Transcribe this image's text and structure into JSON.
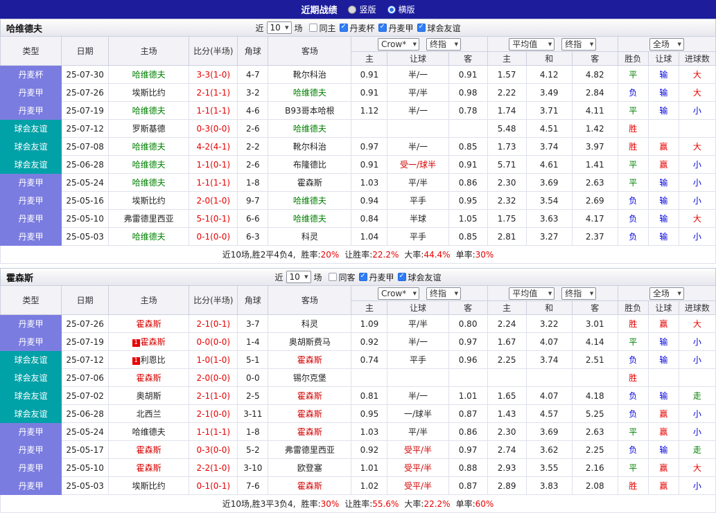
{
  "title_bar": {
    "title": "近期战绩",
    "view_options": [
      {
        "label": "竖版",
        "selected": false
      },
      {
        "label": "横版",
        "selected": true
      }
    ]
  },
  "table_columns": [
    "类型",
    "日期",
    "主场",
    "比分(半场)",
    "角球",
    "客场",
    "主",
    "让球",
    "客",
    "主",
    "和",
    "客",
    "胜负",
    "让球",
    "进球数"
  ],
  "colors": {
    "league_type": "#7b7ce0",
    "friendly_type": "#00a1a7",
    "win": "#e60000",
    "draw": "#008000",
    "loss": "#0000dc",
    "title_bar_bg": "#1d1d9c"
  },
  "sections": [
    {
      "team": "哈维德夫",
      "filters": {
        "near_label": "近",
        "match_count": "10",
        "unit_label": "场",
        "options": [
          {
            "label": "同主",
            "checked": false
          },
          {
            "label": "丹麦杯",
            "checked": true
          },
          {
            "label": "丹麦甲",
            "checked": true
          },
          {
            "label": "球会友谊",
            "checked": true
          }
        ]
      },
      "selectors": {
        "bookmaker": "Crow*",
        "odds_stage": "终指",
        "average": "平均值",
        "average_stage": "终指",
        "scope": "全场"
      },
      "rows": [
        {
          "type": "丹麦杯",
          "date": "25-07-30",
          "home": "哈维德夫",
          "home_hl": "green",
          "score": "3-3(1-0)",
          "corner": "4-7",
          "away": "靴尔科治",
          "odds": [
            "0.91",
            "半/一",
            "0.91"
          ],
          "avg": [
            "1.57",
            "4.12",
            "4.82"
          ],
          "result": "平",
          "hcp": "输",
          "goal": "大"
        },
        {
          "type": "丹麦甲",
          "date": "25-07-26",
          "home": "埃斯比约",
          "score": "2-1(1-1)",
          "corner": "3-2",
          "away": "哈维德夫",
          "away_hl": "green",
          "odds": [
            "0.91",
            "平/半",
            "0.98"
          ],
          "avg": [
            "2.22",
            "3.49",
            "2.84"
          ],
          "result": "负",
          "hcp": "输",
          "goal": "大"
        },
        {
          "type": "丹麦甲",
          "date": "25-07-19",
          "home": "哈维德夫",
          "home_hl": "green",
          "score": "1-1(1-1)",
          "corner": "4-6",
          "away": "B93哥本哈根",
          "odds": [
            "1.12",
            "半/一",
            "0.78"
          ],
          "avg": [
            "1.74",
            "3.71",
            "4.11"
          ],
          "result": "平",
          "hcp": "输",
          "goal": "小"
        },
        {
          "type": "球会友谊",
          "date": "25-07-12",
          "home": "罗斯基德",
          "score": "0-3(0-0)",
          "corner": "2-6",
          "away": "哈维德夫",
          "away_hl": "green",
          "odds": [
            "",
            "",
            ""
          ],
          "avg": [
            "5.48",
            "4.51",
            "1.42"
          ],
          "result": "胜",
          "hcp": "",
          "goal": ""
        },
        {
          "type": "球会友谊",
          "date": "25-07-08",
          "home": "哈维德夫",
          "home_hl": "green",
          "score": "4-2(4-1)",
          "corner": "2-2",
          "away": "靴尔科治",
          "odds": [
            "0.97",
            "半/一",
            "0.85"
          ],
          "avg": [
            "1.73",
            "3.74",
            "3.97"
          ],
          "result": "胜",
          "hcp": "赢",
          "goal": "大"
        },
        {
          "type": "球会友谊",
          "date": "25-06-28",
          "home": "哈维德夫",
          "home_hl": "green",
          "score": "1-1(0-1)",
          "corner": "2-6",
          "away": "布隆德比",
          "odds": [
            "0.91",
            "受一/球半",
            "0.91"
          ],
          "avg": [
            "5.71",
            "4.61",
            "1.41"
          ],
          "result": "平",
          "hcp": "赢",
          "goal": "小"
        },
        {
          "type": "丹麦甲",
          "date": "25-05-24",
          "home": "哈维德夫",
          "home_hl": "green",
          "score": "1-1(1-1)",
          "corner": "1-8",
          "away": "霍森斯",
          "odds": [
            "1.03",
            "平/半",
            "0.86"
          ],
          "avg": [
            "2.30",
            "3.69",
            "2.63"
          ],
          "result": "平",
          "hcp": "输",
          "goal": "小"
        },
        {
          "type": "丹麦甲",
          "date": "25-05-16",
          "home": "埃斯比约",
          "score": "2-0(1-0)",
          "corner": "9-7",
          "away": "哈维德夫",
          "away_hl": "green",
          "odds": [
            "0.94",
            "平手",
            "0.95"
          ],
          "avg": [
            "2.32",
            "3.54",
            "2.69"
          ],
          "result": "负",
          "hcp": "输",
          "goal": "小"
        },
        {
          "type": "丹麦甲",
          "date": "25-05-10",
          "home": "弗雷德里西亚",
          "score": "5-1(0-1)",
          "corner": "6-6",
          "away": "哈维德夫",
          "away_hl": "green",
          "odds": [
            "0.84",
            "半球",
            "1.05"
          ],
          "avg": [
            "1.75",
            "3.63",
            "4.17"
          ],
          "result": "负",
          "hcp": "输",
          "goal": "大"
        },
        {
          "type": "丹麦甲",
          "date": "25-05-03",
          "home": "哈维德夫",
          "home_hl": "green",
          "score": "0-1(0-0)",
          "corner": "6-3",
          "away": "科灵",
          "odds": [
            "1.04",
            "平手",
            "0.85"
          ],
          "avg": [
            "2.81",
            "3.27",
            "2.37"
          ],
          "result": "负",
          "hcp": "输",
          "goal": "小"
        }
      ],
      "summary": {
        "record": "近10场,胜2平4负4,",
        "stats": [
          {
            "label": "胜率:",
            "value": "20%"
          },
          {
            "label": "让胜率:",
            "value": "22.2%"
          },
          {
            "label": "大率:",
            "value": "44.4%"
          },
          {
            "label": "单率:",
            "value": "30%"
          }
        ]
      }
    },
    {
      "team": "霍森斯",
      "filters": {
        "near_label": "近",
        "match_count": "10",
        "unit_label": "场",
        "options": [
          {
            "label": "同客",
            "checked": false
          },
          {
            "label": "丹麦甲",
            "checked": true
          },
          {
            "label": "球会友谊",
            "checked": true
          }
        ]
      },
      "selectors": {
        "bookmaker": "Crow*",
        "odds_stage": "终指",
        "average": "平均值",
        "average_stage": "终指",
        "scope": "全场"
      },
      "rows": [
        {
          "type": "丹麦甲",
          "date": "25-07-26",
          "home": "霍森斯",
          "home_hl": "red",
          "score": "2-1(0-1)",
          "corner": "3-7",
          "away": "科灵",
          "odds": [
            "1.09",
            "平/半",
            "0.80"
          ],
          "avg": [
            "2.24",
            "3.22",
            "3.01"
          ],
          "result": "胜",
          "hcp": "赢",
          "goal": "大"
        },
        {
          "type": "丹麦甲",
          "date": "25-07-19",
          "home": "霍森斯",
          "home_hl": "red",
          "home_badge": "1",
          "score": "0-0(0-0)",
          "corner": "1-4",
          "away": "奥胡斯费马",
          "odds": [
            "0.92",
            "半/一",
            "0.97"
          ],
          "avg": [
            "1.67",
            "4.07",
            "4.14"
          ],
          "result": "平",
          "hcp": "输",
          "goal": "小"
        },
        {
          "type": "球会友谊",
          "date": "25-07-12",
          "home": "利恩比",
          "home_badge": "1",
          "score": "1-0(1-0)",
          "corner": "5-1",
          "away": "霍森斯",
          "away_hl": "red",
          "odds": [
            "0.74",
            "平手",
            "0.96"
          ],
          "avg": [
            "2.25",
            "3.74",
            "2.51"
          ],
          "result": "负",
          "hcp": "输",
          "goal": "小"
        },
        {
          "type": "球会友谊",
          "date": "25-07-06",
          "home": "霍森斯",
          "home_hl": "red",
          "score": "2-0(0-0)",
          "corner": "0-0",
          "away": "锡尔克堡",
          "odds": [
            "",
            "",
            ""
          ],
          "avg": [
            "",
            "",
            ""
          ],
          "result": "胜",
          "hcp": "",
          "goal": ""
        },
        {
          "type": "球会友谊",
          "date": "25-07-02",
          "home": "奥胡斯",
          "score": "2-1(1-0)",
          "corner": "2-5",
          "away": "霍森斯",
          "away_hl": "red",
          "odds": [
            "0.81",
            "半/一",
            "1.01"
          ],
          "avg": [
            "1.65",
            "4.07",
            "4.18"
          ],
          "result": "负",
          "hcp": "输",
          "goal": "走"
        },
        {
          "type": "球会友谊",
          "date": "25-06-28",
          "home": "北西兰",
          "score": "2-1(0-0)",
          "corner": "3-11",
          "away": "霍森斯",
          "away_hl": "red",
          "odds": [
            "0.95",
            "一/球半",
            "0.87"
          ],
          "avg": [
            "1.43",
            "4.57",
            "5.25"
          ],
          "result": "负",
          "hcp": "赢",
          "goal": "小"
        },
        {
          "type": "丹麦甲",
          "date": "25-05-24",
          "home": "哈维德夫",
          "score": "1-1(1-1)",
          "corner": "1-8",
          "away": "霍森斯",
          "away_hl": "red",
          "odds": [
            "1.03",
            "平/半",
            "0.86"
          ],
          "avg": [
            "2.30",
            "3.69",
            "2.63"
          ],
          "result": "平",
          "hcp": "赢",
          "goal": "小"
        },
        {
          "type": "丹麦甲",
          "date": "25-05-17",
          "home": "霍森斯",
          "home_hl": "red",
          "score": "0-3(0-0)",
          "corner": "5-2",
          "away": "弗雷德里西亚",
          "odds": [
            "0.92",
            "受平/半",
            "0.97"
          ],
          "avg": [
            "2.74",
            "3.62",
            "2.25"
          ],
          "result": "负",
          "hcp": "输",
          "goal": "走"
        },
        {
          "type": "丹麦甲",
          "date": "25-05-10",
          "home": "霍森斯",
          "home_hl": "red",
          "score": "2-2(1-0)",
          "corner": "3-10",
          "away": "欧登塞",
          "odds": [
            "1.01",
            "受平/半",
            "0.88"
          ],
          "avg": [
            "2.93",
            "3.55",
            "2.16"
          ],
          "result": "平",
          "hcp": "赢",
          "goal": "大"
        },
        {
          "type": "丹麦甲",
          "date": "25-05-03",
          "home": "埃斯比约",
          "score": "0-1(0-1)",
          "corner": "7-6",
          "away": "霍森斯",
          "away_hl": "red",
          "odds": [
            "1.02",
            "受平/半",
            "0.87"
          ],
          "avg": [
            "2.89",
            "3.83",
            "2.08"
          ],
          "result": "胜",
          "hcp": "赢",
          "goal": "小"
        }
      ],
      "summary": {
        "record": "近10场,胜3平3负4,",
        "stats": [
          {
            "label": "胜率:",
            "value": "30%"
          },
          {
            "label": "让胜率:",
            "value": "55.6%"
          },
          {
            "label": "大率:",
            "value": "22.2%"
          },
          {
            "label": "单率:",
            "value": "60%"
          }
        ]
      }
    }
  ]
}
